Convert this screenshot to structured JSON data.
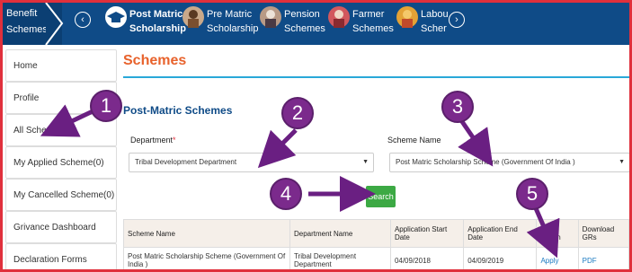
{
  "topnav": {
    "benefit_schemes": "Benefit Schemes",
    "items": [
      {
        "line1": "Post Matric",
        "line2": "Scholarship",
        "active": true
      },
      {
        "line1": "Pre Matric",
        "line2": "Scholarship",
        "active": false
      },
      {
        "line1": "Pension",
        "line2": "Schemes",
        "active": false
      },
      {
        "line1": "Farmer",
        "line2": "Schemes",
        "active": false
      },
      {
        "line1": "Labou",
        "line2": "Scher",
        "active": false
      }
    ],
    "prev_arrow": "‹",
    "next_arrow": "›"
  },
  "sidebar": {
    "items": [
      "Home",
      "Profile",
      "All Schemes",
      "My Applied Scheme(0)",
      "My Cancelled Scheme(0)",
      "Grivance Dashboard",
      "Declaration Forms"
    ]
  },
  "main": {
    "title": "Schemes",
    "section_title": "Post-Matric Schemes",
    "department_label": "Department",
    "department_required": "*",
    "department_value": "Tribal Development Department",
    "scheme_name_label": "Scheme Name",
    "scheme_name_value": "Post Matric Scholarship Scheme (Government Of India )",
    "search_label": "Search"
  },
  "table": {
    "headers": [
      "Scheme Name",
      "Department Name",
      "Application Start Date",
      "Application End Date",
      "Take Action",
      "Download GRs"
    ],
    "rows": [
      [
        "Post Matric Scholarship Scheme (Government Of India )",
        "Tribal Development Department",
        "04/09/2018",
        "04/09/2019",
        "Apply",
        "PDF"
      ]
    ]
  },
  "annotations": {
    "badges": [
      "1",
      "2",
      "3",
      "4",
      "5"
    ]
  },
  "colors": {
    "nav": "#0f4b87",
    "accent_orange": "#e8622c",
    "badge": "#7b2a8c",
    "search": "#3ca944",
    "link": "#1a7ac2",
    "frame": "#e0303c"
  }
}
